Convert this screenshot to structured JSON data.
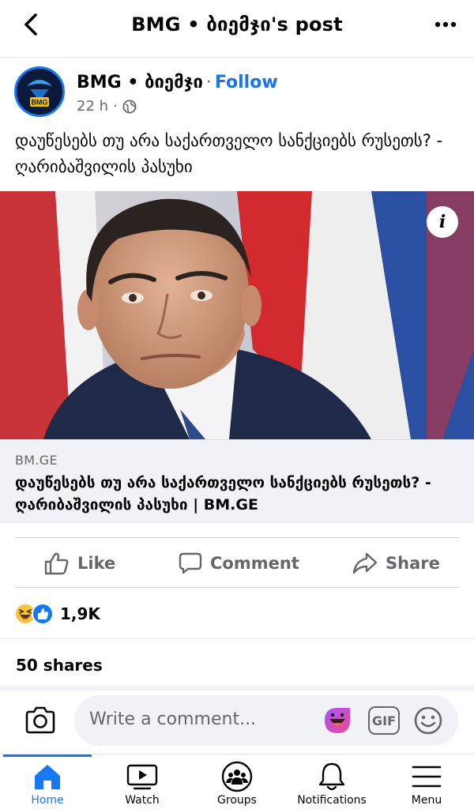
{
  "header": {
    "title": "BMG • ბიემჯი's post",
    "back_icon": "chevron-left-icon",
    "more_icon": "more-horizontal-icon"
  },
  "post": {
    "author": "BMG • ბიემჯი",
    "follow_label": "Follow",
    "time": "22 h",
    "audience_icon": "globe-icon",
    "avatar_text": "BMG",
    "text": "დაუწესებს თუ არა საქართველო სანქციებს რუსეთს? - ღარიბაშვილის პასუხი",
    "info_icon_label": "i"
  },
  "link_preview": {
    "domain": "BM.GE",
    "title": "დაუწესებს თუ არა საქართველო სანქციებს რუსეთს? - ღარიბაშვილის პასუხი | BM.GE"
  },
  "actions": {
    "like_label": "Like",
    "comment_label": "Comment",
    "share_label": "Share"
  },
  "stats": {
    "reactions_count": "1,9K",
    "shares": "50 shares"
  },
  "composer": {
    "placeholder": "Write a comment...",
    "gif_label": "GIF"
  },
  "tabbar": {
    "items": [
      {
        "label": "Home",
        "icon": "home-icon"
      },
      {
        "label": "Watch",
        "icon": "watch-icon"
      },
      {
        "label": "Groups",
        "icon": "groups-icon"
      },
      {
        "label": "Notifications",
        "icon": "bell-icon"
      },
      {
        "label": "Menu",
        "icon": "menu-icon"
      }
    ]
  },
  "colors": {
    "accent": "#1877f2",
    "secondary_text": "#65676b",
    "preview_bg": "#f0f2f5"
  }
}
